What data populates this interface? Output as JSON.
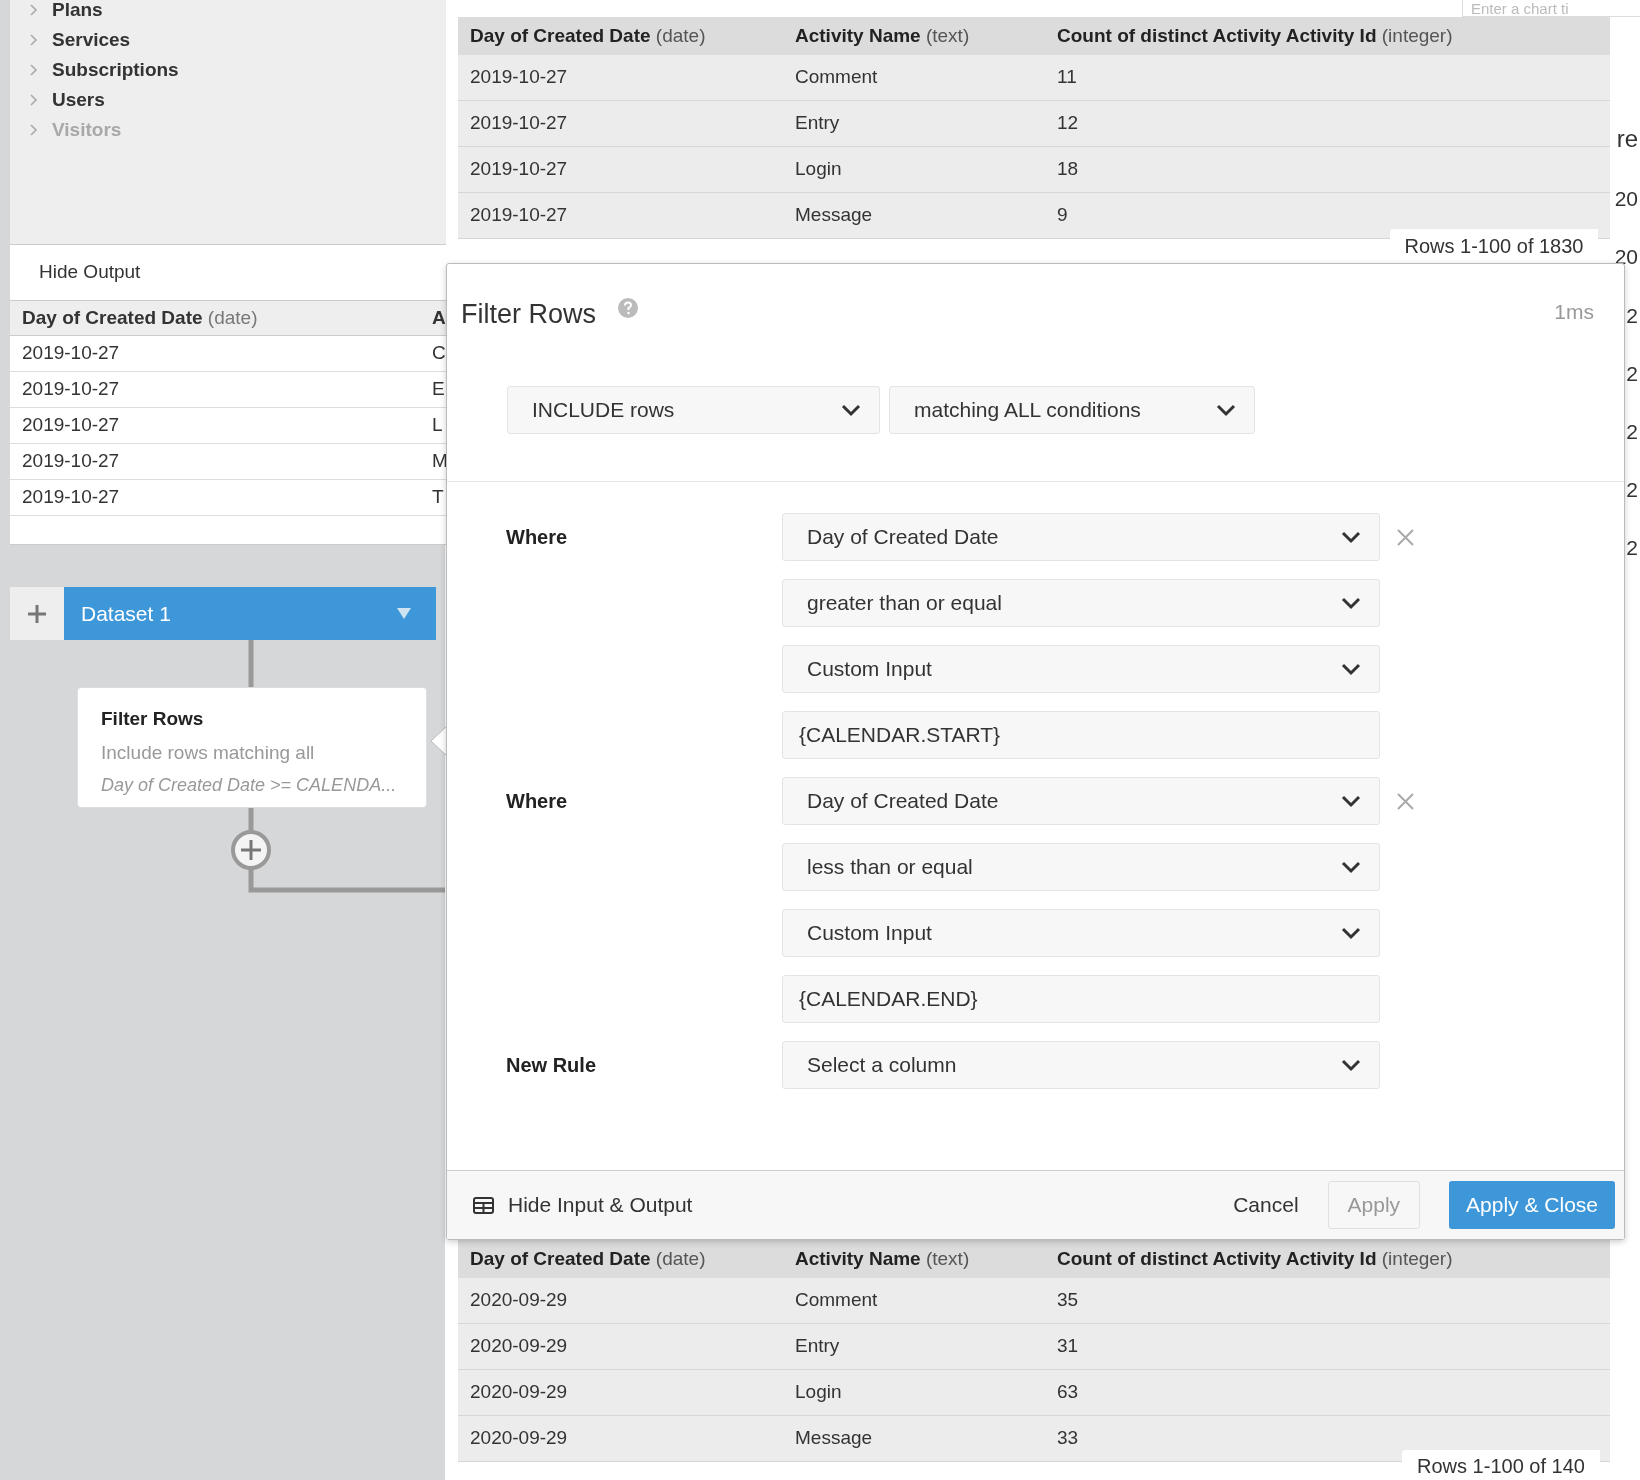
{
  "sidebar": {
    "items": [
      {
        "label": "Plans",
        "disabled": false
      },
      {
        "label": "Services",
        "disabled": false
      },
      {
        "label": "Subscriptions",
        "disabled": false
      },
      {
        "label": "Users",
        "disabled": false
      },
      {
        "label": "Visitors",
        "disabled": true
      }
    ]
  },
  "output_panel": {
    "toggle": "Hide Output",
    "columns": [
      {
        "name": "Day of Created Date",
        "type": "(date)"
      },
      {
        "name": "A"
      }
    ],
    "rows": [
      [
        "2019-10-27",
        "C"
      ],
      [
        "2019-10-27",
        "E"
      ],
      [
        "2019-10-27",
        "L"
      ],
      [
        "2019-10-27",
        "M"
      ],
      [
        "2019-10-27",
        "T"
      ]
    ]
  },
  "pipeline": {
    "dataset": "Dataset 1",
    "steps": [
      {
        "title": "Filter Rows",
        "summary": "Include rows matching all",
        "detail": "Day of Created Date >= CALENDA..."
      }
    ]
  },
  "input_table": {
    "columns": [
      {
        "name": "Day of Created Date",
        "type": "(date)"
      },
      {
        "name": "Activity Name",
        "type": "(text)"
      },
      {
        "name": "Count of distinct Activity Activity Id",
        "type": "(integer)"
      }
    ],
    "rows": [
      [
        "2019-10-27",
        "Comment",
        "11"
      ],
      [
        "2019-10-27",
        "Entry",
        "12"
      ],
      [
        "2019-10-27",
        "Login",
        "18"
      ],
      [
        "2019-10-27",
        "Message",
        "9"
      ]
    ],
    "row_count": "Rows 1-100 of 1830"
  },
  "right_panel": {
    "title_placeholder": "Enter a chart ti",
    "heading": "re",
    "values": [
      "20",
      "20"
    ],
    "covered_values": [
      "2",
      "2",
      "2",
      "2",
      "2"
    ]
  },
  "dialog": {
    "title": "Filter Rows",
    "timing": "1ms",
    "mode": "INCLUDE rows",
    "match": "matching ALL conditions",
    "rules": [
      {
        "label": "Where",
        "column": "Day of Created Date",
        "operator": "greater than or equal",
        "value_source": "Custom Input",
        "value": "{CALENDAR.START}"
      },
      {
        "label": "Where",
        "column": "Day of Created Date",
        "operator": "less than or equal",
        "value_source": "Custom Input",
        "value": "{CALENDAR.END}"
      }
    ],
    "new_rule": {
      "label": "New Rule",
      "placeholder": "Select a column"
    },
    "footer": {
      "toggle": "Hide Input & Output",
      "buttons": [
        {
          "label": "Cancel",
          "kind": "link"
        },
        {
          "label": "Apply",
          "kind": "secondary"
        },
        {
          "label": "Apply & Close",
          "kind": "primary"
        }
      ]
    }
  },
  "output_table": {
    "columns": [
      {
        "name": "Day of Created Date",
        "type": "(date)"
      },
      {
        "name": "Activity Name",
        "type": "(text)"
      },
      {
        "name": "Count of distinct Activity Activity Id",
        "type": "(integer)"
      }
    ],
    "rows": [
      [
        "2020-09-29",
        "Comment",
        "35"
      ],
      [
        "2020-09-29",
        "Entry",
        "31"
      ],
      [
        "2020-09-29",
        "Login",
        "63"
      ],
      [
        "2020-09-29",
        "Message",
        "33"
      ]
    ],
    "row_count": "Rows 1-100 of 140"
  }
}
